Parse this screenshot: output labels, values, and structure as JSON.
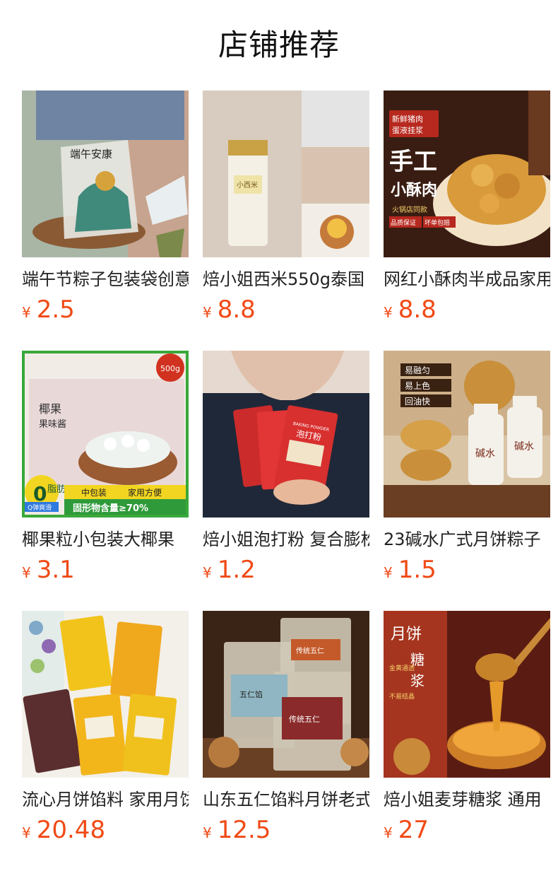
{
  "page": {
    "title": "店铺推荐"
  },
  "currency_symbol": "¥",
  "accent_color": "#f04a16",
  "products": [
    {
      "name": "端午节粽子包装袋创意",
      "price": "2.5",
      "image_texts": [
        "端午安康"
      ]
    },
    {
      "name": "焙小姐西米550g泰国",
      "price": "8.8",
      "image_texts": [
        "小西米"
      ]
    },
    {
      "name": "网红小酥肉半成品家用",
      "price": "8.8",
      "image_texts": [
        "新鲜猪肉",
        "蛋液挂浆",
        "手工",
        "小酥肉",
        "火锅店同款",
        "品质保证",
        "坏单包赔"
      ]
    },
    {
      "name": "椰果粒小包装大椰果",
      "price": "3.1",
      "image_texts": [
        "500g",
        "椰果",
        "果味酱",
        "0",
        "脂肪",
        "Q弹爽滑",
        "中包装",
        "家用方便",
        "固形物含量≥70%"
      ]
    },
    {
      "name": "焙小姐泡打粉 复合膨松剂",
      "price": "1.2",
      "image_texts": [
        "BAKING POWDER",
        "泡打粉"
      ]
    },
    {
      "name": "23碱水广式月饼粽子",
      "price": "1.5",
      "image_texts": [
        "易融匀",
        "易上色",
        "回油快",
        "碱水"
      ]
    },
    {
      "name": "流心月饼馅料 家用月饼",
      "price": "20.48",
      "image_texts": []
    },
    {
      "name": "山东五仁馅料月饼老式",
      "price": "12.5",
      "image_texts": [
        "五仁馅",
        "传统五仁"
      ]
    },
    {
      "name": "焙小姐麦芽糖浆 通用",
      "price": "27",
      "image_texts": [
        "月饼",
        "糖",
        "浆",
        "金黄通透",
        "不易结晶"
      ]
    }
  ]
}
